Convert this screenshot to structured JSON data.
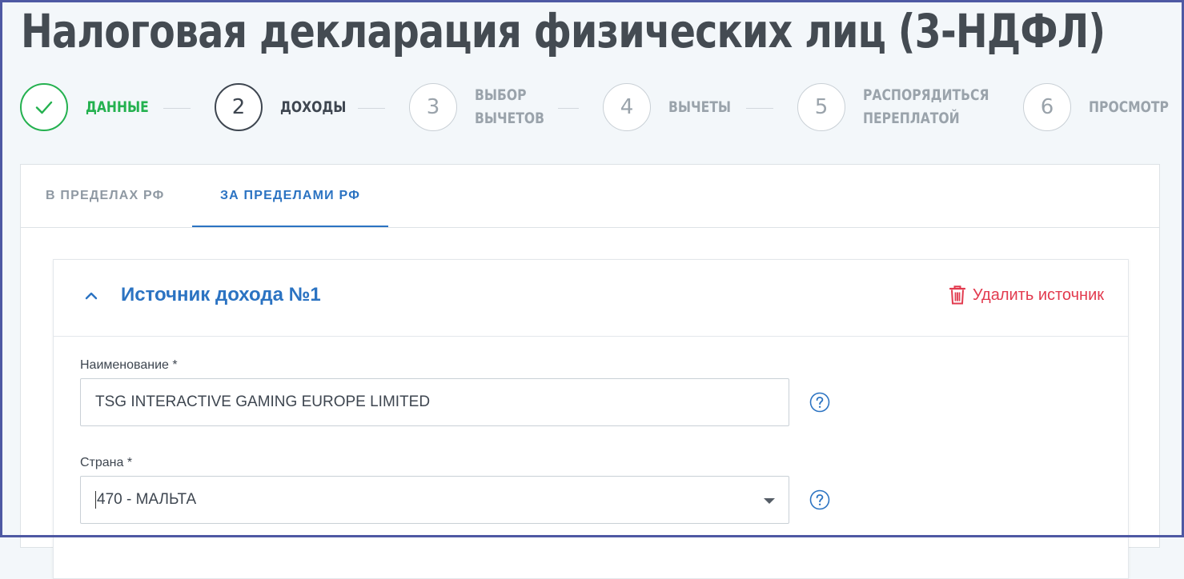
{
  "page": {
    "title": "Налоговая декларация физических лиц (3-НДФЛ)"
  },
  "stepper": {
    "steps": [
      {
        "number": "",
        "label_line1": "ДАННЫЕ",
        "label_line2": "",
        "state": "done"
      },
      {
        "number": "2",
        "label_line1": "ДОХОДЫ",
        "label_line2": "",
        "state": "active"
      },
      {
        "number": "3",
        "label_line1": "ВЫБОР",
        "label_line2": "ВЫЧЕТОВ",
        "state": "pending"
      },
      {
        "number": "4",
        "label_line1": "ВЫЧЕТЫ",
        "label_line2": "",
        "state": "pending"
      },
      {
        "number": "5",
        "label_line1": "РАСПОРЯДИТЬСЯ",
        "label_line2": "ПЕРЕПЛАТОЙ",
        "state": "pending"
      },
      {
        "number": "6",
        "label_line1": "ПРОСМОТР",
        "label_line2": "",
        "state": "pending"
      }
    ]
  },
  "tabs": {
    "items": [
      {
        "label": "В ПРЕДЕЛАХ РФ",
        "active": false
      },
      {
        "label": "ЗА ПРЕДЕЛАМИ РФ",
        "active": true
      }
    ]
  },
  "source": {
    "title": "Источник дохода №1",
    "delete_label": "Удалить источник",
    "name_field": {
      "label": "Наименование *",
      "value": "TSG INTERACTIVE GAMING EUROPE LIMITED"
    },
    "country_field": {
      "label": "Страна *",
      "value": "470 - МАЛЬТА"
    }
  },
  "colors": {
    "accent": "#2b73c2",
    "success": "#24b14f",
    "danger": "#e23a4e",
    "frame": "#4e59a3"
  },
  "icons": {
    "done_step": "check-icon",
    "collapse": "chevron-up-icon",
    "delete": "trash-icon",
    "help": "question-circle-icon",
    "select": "caret-down-icon"
  }
}
